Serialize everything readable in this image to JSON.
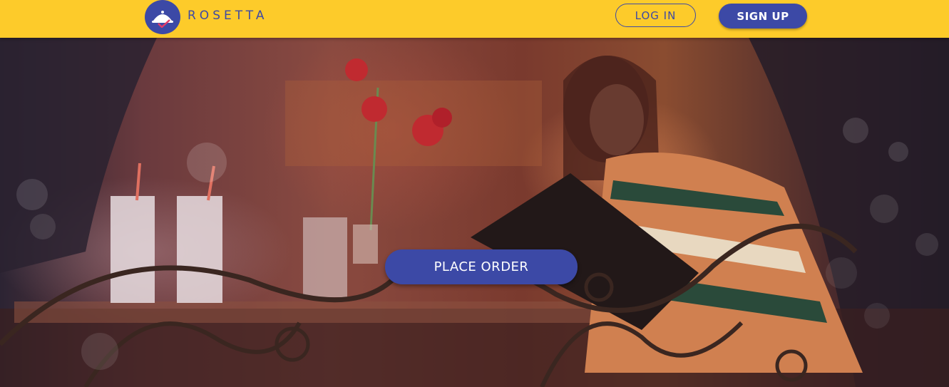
{
  "navbar": {
    "brand": "ROSETTA",
    "login_label": "LOG IN",
    "signup_label": "SIGN UP",
    "logo_icon": "cloche-icon"
  },
  "hero": {
    "place_order_label": "PLACE ORDER",
    "image_description_icon": "restaurant-photo"
  },
  "colors": {
    "navbar_bg": "#fdcb2a",
    "accent": "#3c49a6",
    "button_text": "#ffffff"
  }
}
